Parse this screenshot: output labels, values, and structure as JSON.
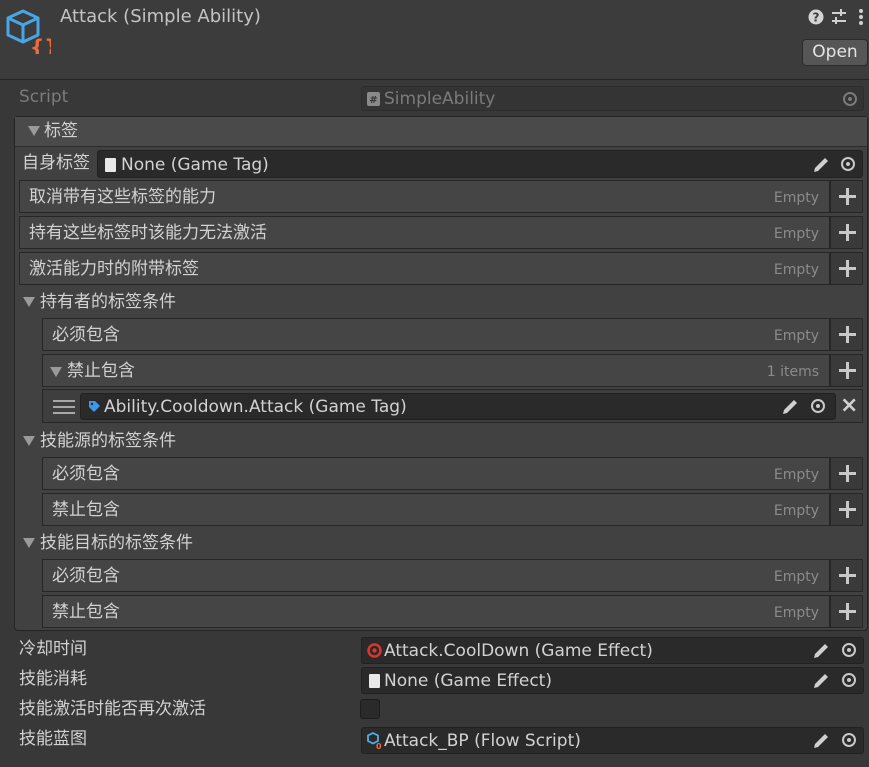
{
  "header": {
    "title": "Attack (Simple Ability)",
    "open_label": "Open"
  },
  "script_row": {
    "label": "Script",
    "value": "SimpleAbility"
  },
  "tags_group": {
    "title": "标签",
    "self_tag": {
      "label": "自身标签",
      "value": "None (Game Tag)"
    },
    "lists": [
      {
        "label": "取消带有这些标签的能力",
        "status": "Empty"
      },
      {
        "label": "持有这些标签时该能力无法激活",
        "status": "Empty"
      },
      {
        "label": "激活能力时的附带标签",
        "status": "Empty"
      }
    ],
    "owner": {
      "title": "持有者的标签条件",
      "must_label": "必须包含",
      "must_status": "Empty",
      "forbid_label": "禁止包含",
      "forbid_status": "1 items",
      "forbid_item": "Ability.Cooldown.Attack (Game Tag)"
    },
    "source": {
      "title": "技能源的标签条件",
      "must_label": "必须包含",
      "must_status": "Empty",
      "forbid_label": "禁止包含",
      "forbid_status": "Empty"
    },
    "target": {
      "title": "技能目标的标签条件",
      "must_label": "必须包含",
      "must_status": "Empty",
      "forbid_label": "禁止包含",
      "forbid_status": "Empty"
    }
  },
  "cooldown": {
    "label": "冷却时间",
    "value": "Attack.CoolDown (Game Effect)"
  },
  "cost": {
    "label": "技能消耗",
    "value": "None (Game Effect)"
  },
  "reactivate": {
    "label": "技能激活时能否再次激活",
    "checked": false
  },
  "blueprint": {
    "label": "技能蓝图",
    "value": "Attack_BP (Flow Script)"
  },
  "colors": {
    "background": "#383838",
    "field": "#2a2a2a",
    "tag_icon": "#3f97e8",
    "effect_icon": "#e0342a",
    "asset_icon": "#4fb0e8"
  }
}
